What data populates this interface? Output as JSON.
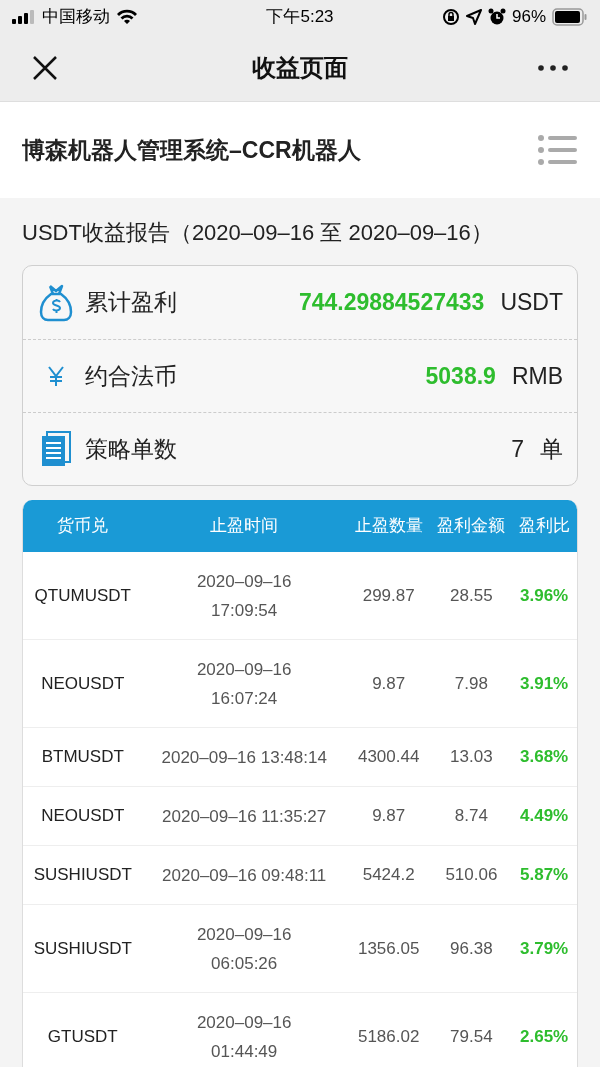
{
  "status_bar": {
    "carrier": "中国移动",
    "time": "下午5:23",
    "battery": "96%"
  },
  "nav": {
    "title": "收益页面"
  },
  "header": {
    "title": "博森机器人管理系统–CCR机器人"
  },
  "report_title": "USDT收益报告（2020–09–16 至 2020–09–16）",
  "summary": [
    {
      "kind": "bag",
      "label": "累计盈利",
      "value": "744.29884527433",
      "unit": "USDT",
      "highlight": true
    },
    {
      "kind": "yen",
      "label": "约合法币",
      "value": "5038.9",
      "unit": "RMB",
      "highlight": true
    },
    {
      "kind": "doc",
      "label": "策略单数",
      "value": "7",
      "unit": "单",
      "highlight": false
    }
  ],
  "table": {
    "columns": [
      "货币兑",
      "止盈时间",
      "止盈数量",
      "盈利金额",
      "盈利比"
    ],
    "rows": [
      {
        "pair": "QTUMUSDT",
        "time": "2020–09–16 17:09:54",
        "wrapped": true,
        "qty": "299.87",
        "amount": "28.55",
        "ratio": "3.96%"
      },
      {
        "pair": "NEOUSDT",
        "time": "2020–09–16 16:07:24",
        "wrapped": true,
        "qty": "9.87",
        "amount": "7.98",
        "ratio": "3.91%"
      },
      {
        "pair": "BTMUSDT",
        "time": "2020–09–16 13:48:14",
        "wrapped": false,
        "qty": "4300.44",
        "amount": "13.03",
        "ratio": "3.68%"
      },
      {
        "pair": "NEOUSDT",
        "time": "2020–09–16 11:35:27",
        "wrapped": false,
        "qty": "9.87",
        "amount": "8.74",
        "ratio": "4.49%"
      },
      {
        "pair": "SUSHIUSDT",
        "time": "2020–09–16 09:48:11",
        "wrapped": false,
        "qty": "5424.2",
        "amount": "510.06",
        "ratio": "5.87%"
      },
      {
        "pair": "SUSHIUSDT",
        "time": "2020–09–16 06:05:26",
        "wrapped": true,
        "qty": "1356.05",
        "amount": "96.38",
        "ratio": "3.79%"
      },
      {
        "pair": "GTUSDT",
        "time": "2020–09–16 01:44:49",
        "wrapped": true,
        "qty": "5186.02",
        "amount": "79.54",
        "ratio": "2.65%"
      }
    ]
  }
}
